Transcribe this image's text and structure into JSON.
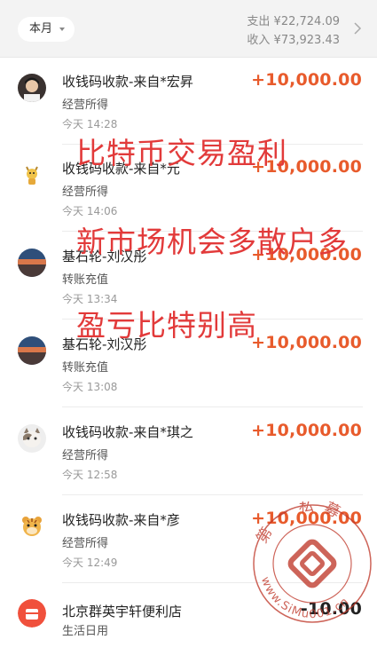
{
  "header": {
    "month_label": "本月",
    "expense": "支出 ¥22,724.09",
    "income": "收入 ¥73,923.43"
  },
  "transactions": [
    {
      "title": "收钱码收款-来自*宏昇",
      "subtitle": "经营所得",
      "time": "今天  14:28",
      "amount": "+10,000.00",
      "avatar": "photo-portrait-avatar"
    },
    {
      "title": "收钱码收款-来自*元",
      "subtitle": "经营所得",
      "time": "今天  14:06",
      "amount": "+10,000.00",
      "avatar": "cartoon-deer-avatar"
    },
    {
      "title": "基石轮-刘汉彤",
      "subtitle": "转账充值",
      "time": "今天  13:34",
      "amount": "+10,000.00",
      "avatar": "sunset-landscape-avatar"
    },
    {
      "title": "基石轮-刘汉彤",
      "subtitle": "转账充值",
      "time": "今天  13:08",
      "amount": "+10,000.00",
      "avatar": "sunset-landscape-avatar"
    },
    {
      "title": "收钱码收款-来自*琪之",
      "subtitle": "经营所得",
      "time": "今天  12:58",
      "amount": "+10,000.00",
      "avatar": "kitten-avatar"
    },
    {
      "title": "收钱码收款-来自*彦",
      "subtitle": "经营所得",
      "time": "今天  12:49",
      "amount": "+10,000.00",
      "avatar": "cartoon-tiger-avatar"
    },
    {
      "title": "北京群英宇轩便利店",
      "subtitle": "生活日用",
      "time": "",
      "amount": "-10.00",
      "avatar": "store-bag-avatar"
    }
  ],
  "overlay_text": {
    "line1": "比特币交易盈利",
    "line2": "新市场机会多散户多",
    "line3": "盈亏比特别高"
  },
  "watermark": {
    "top_text": "第一私募",
    "bottom_text": "www.SiMu001.cn"
  },
  "colors": {
    "amount_positive": "#e85b2c",
    "overlay_red": "#e23a3a",
    "watermark_red": "#c0392b"
  }
}
